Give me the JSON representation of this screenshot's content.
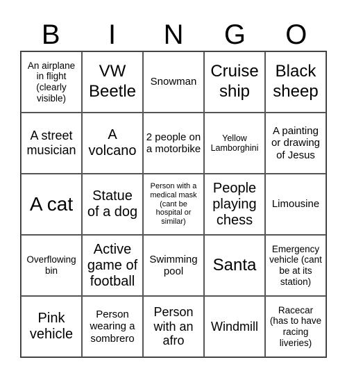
{
  "header": {
    "letters": [
      "B",
      "I",
      "N",
      "G",
      "O"
    ]
  },
  "cells": [
    "An airplane in flight (clearly visible)",
    "VW Beetle",
    "Snowman",
    "Cruise ship",
    "Black sheep",
    "A street musician",
    "A volcano",
    "2 people on a motorbike",
    "Yellow Lamborghini",
    "A painting or drawing of Jesus",
    "A cat",
    "Statue of a dog",
    "Person with a medical mask (cant be hospital or similar)",
    "People playing chess",
    "Limousine",
    "Overflowing bin",
    "Active game of football",
    "Swimming pool",
    "Santa",
    "Emergency vehicle (cant be at its station)",
    "Pink vehicle",
    "Person wearing a sombrero",
    "Person with an afro",
    "Windmill",
    "Racecar (has to have racing liveries)"
  ]
}
